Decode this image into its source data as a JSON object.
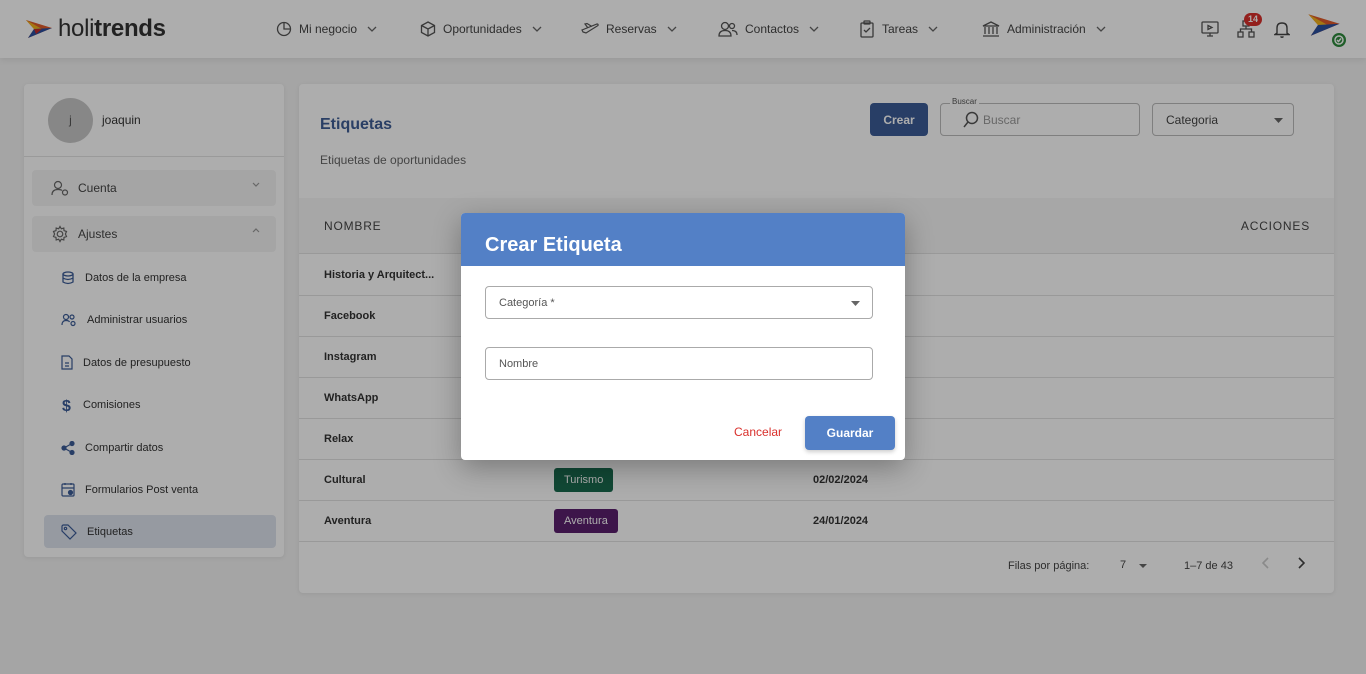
{
  "brand": {
    "name_light": "holi",
    "name_bold": "trends"
  },
  "nav": [
    {
      "label": "Mi negocio",
      "icon": "pie-chart-icon"
    },
    {
      "label": "Oportunidades",
      "icon": "box-icon"
    },
    {
      "label": "Reservas",
      "icon": "plane-icon"
    },
    {
      "label": "Contactos",
      "icon": "users-icon"
    },
    {
      "label": "Tareas",
      "icon": "clipboard-icon"
    },
    {
      "label": "Administración",
      "icon": "bank-icon"
    }
  ],
  "top_icons": {
    "notifications_count": "14"
  },
  "sidebar": {
    "user_initial": "j",
    "user_name": "joaquin",
    "groups": [
      {
        "label": "Cuenta",
        "icon": "user-gear-icon"
      },
      {
        "label": "Ajustes",
        "icon": "gear-icon"
      }
    ],
    "items": [
      {
        "label": "Datos de la empresa",
        "icon": "database-icon"
      },
      {
        "label": "Administrar usuarios",
        "icon": "users-cog-icon"
      },
      {
        "label": "Datos de presupuesto",
        "icon": "file-icon"
      },
      {
        "label": "Comisiones",
        "icon": "dollar-icon"
      },
      {
        "label": "Compartir datos",
        "icon": "share-icon"
      },
      {
        "label": "Formularios Post venta",
        "icon": "calendar-icon"
      },
      {
        "label": "Etiquetas",
        "icon": "tag-icon"
      }
    ]
  },
  "page": {
    "title": "Etiquetas",
    "subtitle": "Etiquetas de oportunidades",
    "create_label": "Crear",
    "search_legend": "Buscar",
    "search_placeholder": "Buscar",
    "category_filter": "Categoria"
  },
  "table": {
    "headers": {
      "name": "NOMBRE",
      "actions": "ACCIONES"
    },
    "rows": [
      {
        "name": "Historia y Arquitect...",
        "tag": "",
        "tag_color": "",
        "date": ""
      },
      {
        "name": "Facebook",
        "tag": "",
        "tag_color": "",
        "date": ""
      },
      {
        "name": "Instagram",
        "tag": "",
        "tag_color": "",
        "date": ""
      },
      {
        "name": "WhatsApp",
        "tag": "",
        "tag_color": "",
        "date": ""
      },
      {
        "name": "Relax",
        "tag": "",
        "tag_color": "",
        "date": ""
      },
      {
        "name": "Cultural",
        "tag": "Turismo",
        "tag_color": "#1a6b4f",
        "date": "02/02/2024"
      },
      {
        "name": "Aventura",
        "tag": "Aventura",
        "tag_color": "#5a1f6e",
        "date": "24/01/2024"
      }
    ]
  },
  "pagination": {
    "rows_per_page_label": "Filas por página:",
    "rows_per_page": "7",
    "range": "1–7 de 43"
  },
  "modal": {
    "title": "Crear Etiqueta",
    "category_label": "Categoría *",
    "name_label": "Nombre",
    "cancel_label": "Cancelar",
    "save_label": "Guardar"
  },
  "colors": {
    "primary": "#3b5c97",
    "modal_header": "#5380c6",
    "danger": "#d9302c",
    "title": "#3e5e96"
  }
}
